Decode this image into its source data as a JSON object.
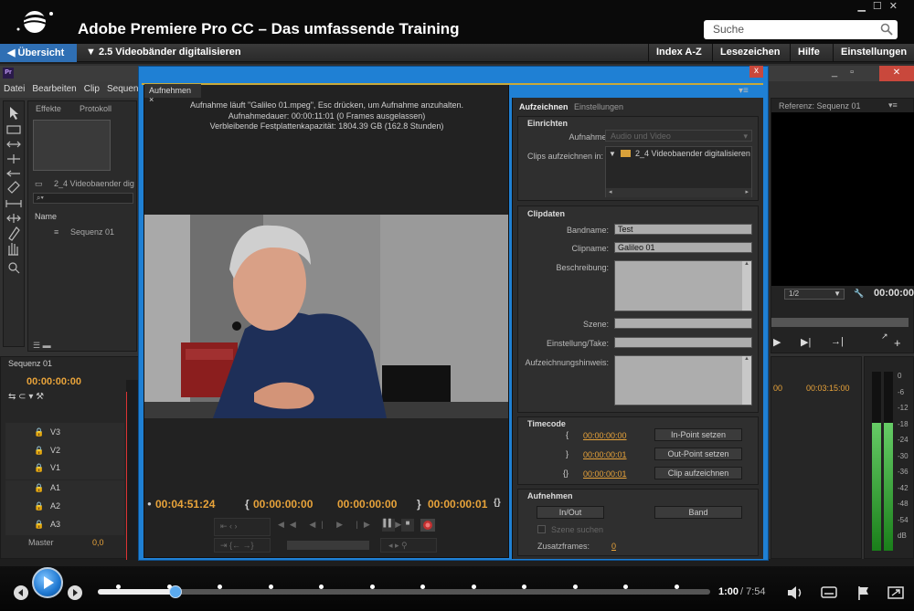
{
  "header": {
    "title": "Adobe Premiere Pro CC – Das umfassende Training",
    "search_placeholder": "Suche"
  },
  "nav": {
    "back_label": "Übersicht",
    "chapter_label": "2.5 Videobänder digitalisieren",
    "right_buttons": [
      "Index A-Z",
      "Lesezeichen",
      "Hilfe",
      "Einstellungen"
    ]
  },
  "premiere": {
    "app_badge": "Pr",
    "menu": [
      "Datei",
      "Bearbeiten",
      "Clip",
      "Sequen"
    ],
    "project_tabs": [
      "Effekte",
      "Protokoll"
    ],
    "bin_path": "2_4 Videobaender dig",
    "name_header": "Name",
    "sequence_item": "Sequenz 01",
    "reference_tab": "Referenz: Sequenz 01",
    "ref_zoom": "1/2",
    "ref_timecode": "00:00:00",
    "ref_ruler_time": "00:03:15:00",
    "timeline_tab": "Sequenz 01",
    "timeline_timecode": "00:00:00:00",
    "tracks_video": [
      "V3",
      "V2",
      "V1"
    ],
    "tracks_audio": [
      "A1",
      "A2",
      "A3"
    ],
    "master_label": "Master",
    "master_value": "0,0",
    "meter_labels": [
      "0",
      "-6",
      "-12",
      "-18",
      "-24",
      "-30",
      "-36",
      "-42",
      "-48",
      "-54",
      "dB"
    ]
  },
  "capture": {
    "tab_label": "Aufnehmen",
    "status_lines": [
      "Aufnahme läuft \"Galileo 01.mpeg\", Esc drücken, um Aufnahme anzuhalten.",
      "Aufnahmedauer: 00:00:11:01  (0 Frames ausgelassen)",
      "Verbleibende Festplattenkapazität: 1804.39 GB (162.8 Stunden)"
    ],
    "timecode_main": "00:04:51:24",
    "timecode_in": "00:00:00:00",
    "timecode_out": "00:00:00:00",
    "timecode_dur": "00:00:00:01"
  },
  "settings": {
    "tabs": [
      "Aufzeichnen",
      "Einstellungen"
    ],
    "einrichten": {
      "header": "Einrichten",
      "aufnahme_label": "Aufnahme:",
      "aufnahme_value": "Audio und Video",
      "clips_label": "Clips aufzeichnen in:",
      "clips_folder": "2_4 Videobaender digitalisieren"
    },
    "clipdaten": {
      "header": "Clipdaten",
      "bandname_label": "Bandname:",
      "bandname_value": "Test",
      "clipname_label": "Clipname:",
      "clipname_value": "Galileo 01",
      "beschreibung_label": "Beschreibung:",
      "szene_label": "Szene:",
      "take_label": "Einstellung/Take:",
      "hinweis_label": "Aufzeichnungshinweis:"
    },
    "timecode": {
      "header": "Timecode",
      "in_value": "00:00:00:00",
      "out_value": "00:00:00:01",
      "dur_value": "00:00:00:01",
      "in_button": "In-Point setzen",
      "out_button": "Out-Point setzen",
      "clip_button": "Clip aufzeichnen"
    },
    "aufnehmen": {
      "header": "Aufnehmen",
      "inout_button": "In/Out",
      "band_button": "Band",
      "szene_check_label": "Szene suchen",
      "zusatz_label": "Zusatzframes:",
      "zusatz_value": "0"
    }
  },
  "player": {
    "current_time": "1:00",
    "total_time": "/ 7:54",
    "progress": 0.127
  },
  "colors": {
    "accent_blue": "#1f80d4",
    "timecode_orange": "#e8a33a",
    "nav_active": "#2f6fb4"
  }
}
